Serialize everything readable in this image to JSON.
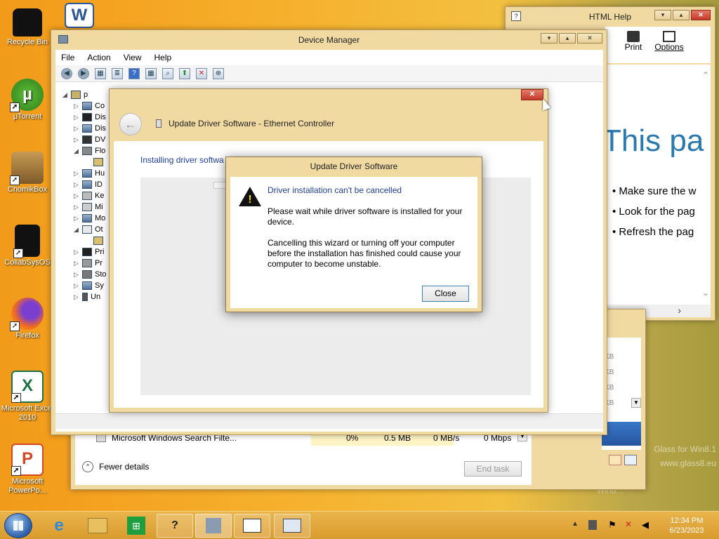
{
  "desktop": {
    "icons": [
      {
        "label": "Recycle Bin"
      },
      {
        "label": "µTorrent"
      },
      {
        "label": "ChomikBox"
      },
      {
        "label": "CollabSysOS"
      },
      {
        "label": "Firefox"
      },
      {
        "label": "Microsoft Excel 2010"
      },
      {
        "label": "Microsoft PowerPo..."
      }
    ],
    "watermark": {
      "line1": "Glass for Win8.1",
      "line2": "www.glass8.eu",
      "line3": "Wind..."
    }
  },
  "html_help": {
    "title": "HTML Help",
    "toolbar": {
      "print": "Print",
      "options": "Options"
    },
    "heading": "This pa",
    "bullets": [
      "Make sure the w",
      "Look for the pag",
      "Refresh the pag"
    ]
  },
  "task_manager": {
    "row": {
      "name": "Microsoft Windows Search Filte...",
      "cpu": "0%",
      "memory": "0.5 MB",
      "disk": "0 MB/s",
      "network": "0 Mbps"
    },
    "fewer_details": "Fewer details",
    "end_task": "End task",
    "kb_labels": [
      "KB",
      "KB",
      "KB",
      "KB"
    ]
  },
  "device_manager": {
    "title": "Device Manager",
    "menu": [
      "File",
      "Action",
      "View",
      "Help"
    ],
    "tree": [
      {
        "label": "p",
        "exp": "◢"
      },
      {
        "label": "Co",
        "exp": "▷"
      },
      {
        "label": "Dis",
        "exp": "▷"
      },
      {
        "label": "Dis",
        "exp": "▷"
      },
      {
        "label": "DV",
        "exp": "▷"
      },
      {
        "label": "Flo",
        "exp": "◢"
      },
      {
        "label": "",
        "exp": ""
      },
      {
        "label": "Hu",
        "exp": "▷"
      },
      {
        "label": "ID",
        "exp": "▷"
      },
      {
        "label": "Ke",
        "exp": "▷"
      },
      {
        "label": "Mi",
        "exp": "▷"
      },
      {
        "label": "Mo",
        "exp": "▷"
      },
      {
        "label": "Ot",
        "exp": "◢"
      },
      {
        "label": "",
        "exp": ""
      },
      {
        "label": "Pri",
        "exp": "▷"
      },
      {
        "label": "Pr",
        "exp": "▷"
      },
      {
        "label": "Sto",
        "exp": "▷"
      },
      {
        "label": "Sy",
        "exp": "▷"
      },
      {
        "label": "Un",
        "exp": "▷"
      }
    ]
  },
  "update_driver": {
    "title": "Update Driver Software - Ethernet Controller",
    "status": "Installing driver softwa"
  },
  "dialog": {
    "title": "Update Driver Software",
    "heading": "Driver installation can't be cancelled",
    "para1": "Please wait while driver software is installed for your device.",
    "para2": "Cancelling this wizard or turning off your computer before the installation has finished could cause your computer to become unstable.",
    "close_label": "Close"
  },
  "taskbar": {
    "time": "12:34 PM",
    "date": "6/23/2023"
  }
}
